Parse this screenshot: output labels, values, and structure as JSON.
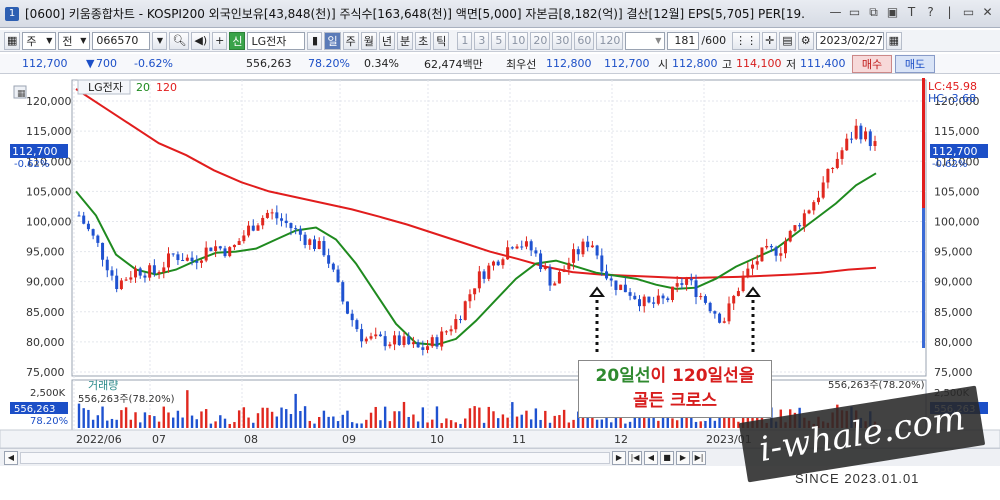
{
  "window": {
    "badge": "1",
    "title": "[0600] 키움종합차트 - KOSPI200 외국인보유[43,848(천)] 주식수[163,648(천)] 액면[5,000] 자본금[8,182(억)] 결산[12월] EPS[5,705] PER[19.",
    "controls": [
      "—",
      "▭",
      "⧉",
      "▣",
      "T",
      "?",
      "|",
      "▭",
      "✕"
    ]
  },
  "toolbar": {
    "period_select": "주",
    "all_label": "전",
    "stock_code": "066570",
    "new_badge": "신",
    "stock_name": "LG전자",
    "periods": [
      "일",
      "주",
      "월",
      "년",
      "분",
      "초",
      "틱"
    ],
    "intervals": [
      "1",
      "3",
      "5",
      "10",
      "20",
      "30",
      "60",
      "120"
    ],
    "count": "181",
    "count_total": "/600",
    "date": "2023/02/27"
  },
  "quote": {
    "price": "112,700",
    "change": "700",
    "change_pct": "-0.62%",
    "volume": "556,263",
    "vol_ratio": "78.20%",
    "turnover": "0.34%",
    "amount": "62,474백만",
    "best_label": "최우선",
    "best_ask": "112,800",
    "best_bid": "112,700",
    "open_label": "시",
    "open": "112,800",
    "high_label": "고",
    "high": "114,100",
    "low_label": "저",
    "low": "111,400",
    "buy_button": "매수",
    "sell_button": "매도"
  },
  "chart_labels": {
    "legend_name": "LG전자",
    "legend_ma20": "20",
    "legend_ma120": "120",
    "lc": "LC:45.98",
    "hc": "HC:-3.68",
    "price_tag": "112,700",
    "price_tag_pct": "-0.62%",
    "volume_title": "거래량",
    "volume_value": "556,263주(78.20%)",
    "volume_tag": "556,263",
    "volume_tag_pct": "78.20%",
    "volume_ticks": [
      "2,500K",
      "0"
    ]
  },
  "chart_data": {
    "type": "candlestick",
    "price_ylim": [
      75000,
      122500
    ],
    "price_ticks": [
      "120,000",
      "115,000",
      "110,000",
      "105,000",
      "100,000",
      "95,000",
      "90,000",
      "85,000",
      "80,000",
      "75,000"
    ],
    "x_labels": [
      "2022/06",
      "07",
      "08",
      "09",
      "10",
      "11",
      "12",
      "2023/01"
    ],
    "series": [
      {
        "name": "20",
        "color": "#1f8a1f"
      },
      {
        "name": "120",
        "color": "#e11d1d"
      }
    ],
    "close_approx": [
      101000,
      96000,
      89500,
      92000,
      91500,
      94500,
      93500,
      96000,
      95000,
      99000,
      101500,
      99500,
      97000,
      95000,
      86000,
      80500,
      80200,
      80000,
      78700,
      80500,
      84000,
      90500,
      93500,
      97000,
      95000,
      89500,
      94000,
      97000,
      90000,
      88500,
      86000,
      87000,
      90500,
      87000,
      83500,
      90500,
      94500,
      95500,
      100000,
      104500,
      110500,
      115500,
      112700
    ],
    "ma20_approx": [
      105000,
      101000,
      94500,
      92000,
      91200,
      92000,
      93500,
      94800,
      95000,
      95500,
      97000,
      98500,
      99000,
      97000,
      93000,
      88000,
      83000,
      79800,
      79500,
      80500,
      83500,
      87000,
      90500,
      93000,
      93500,
      92500,
      91500,
      91000,
      90500,
      89500,
      88800,
      89000,
      90500,
      92500,
      94000,
      95500,
      98000,
      100500,
      103000,
      106000,
      108000
    ],
    "ma120_approx": [
      122000,
      119000,
      116000,
      113000,
      111000,
      108500,
      106500,
      105000,
      104000,
      103000,
      102000,
      100800,
      99500,
      98000,
      96500,
      95000,
      93800,
      92500,
      91600,
      91200,
      91000,
      90800,
      90600,
      90700,
      90800,
      91000,
      91200,
      91500,
      92000,
      92300
    ]
  },
  "annotation": {
    "line1_green": "20일선",
    "line1_red_a": "이 ",
    "line1_red_b": "120일선을",
    "line2": "골든 크로스"
  },
  "watermark": {
    "text": "i-whale.com",
    "since": "SINCE 2023.01.01"
  }
}
